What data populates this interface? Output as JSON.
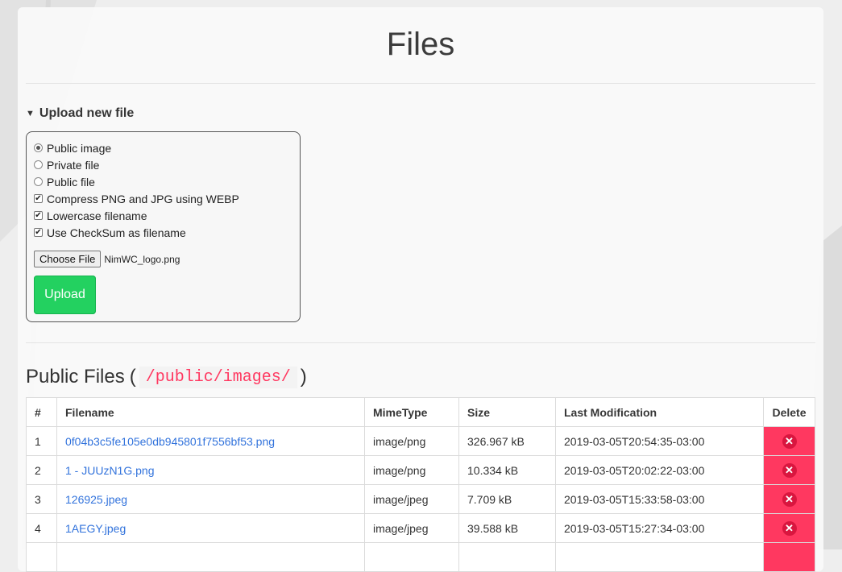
{
  "page": {
    "title": "Files"
  },
  "upload": {
    "summary": "Upload new file",
    "options": [
      {
        "type": "radio",
        "label": "Public image",
        "checked": true
      },
      {
        "type": "radio",
        "label": "Private file",
        "checked": false
      },
      {
        "type": "radio",
        "label": "Public file",
        "checked": false
      },
      {
        "type": "checkbox",
        "label": "Compress PNG and JPG using WEBP",
        "checked": true
      },
      {
        "type": "checkbox",
        "label": "Lowercase filename",
        "checked": true
      },
      {
        "type": "checkbox",
        "label": "Use CheckSum as filename",
        "checked": true
      }
    ],
    "choose_file_label": "Choose File",
    "chosen_file": "NimWC_logo.png",
    "upload_label": "Upload"
  },
  "public_files": {
    "title": "Public Files",
    "path": "/public/images/",
    "columns": [
      "#",
      "Filename",
      "MimeType",
      "Size",
      "Last Modification",
      "Delete"
    ],
    "rows": [
      {
        "num": "1",
        "filename": "0f04b3c5fe105e0db945801f7556bf53.png",
        "mime": "image/png",
        "size": "326.967 kB",
        "modified": "2019-03-05T20:54:35-03:00"
      },
      {
        "num": "2",
        "filename": "1 - JUUzN1G.png",
        "mime": "image/png",
        "size": "10.334 kB",
        "modified": "2019-03-05T20:02:22-03:00"
      },
      {
        "num": "3",
        "filename": "126925.jpeg",
        "mime": "image/jpeg",
        "size": "7.709 kB",
        "modified": "2019-03-05T15:33:58-03:00"
      },
      {
        "num": "4",
        "filename": "1AEGY.jpeg",
        "mime": "image/jpeg",
        "size": "39.588 kB",
        "modified": "2019-03-05T15:27:34-03:00"
      }
    ]
  },
  "colors": {
    "accent_green": "#23d160",
    "danger": "#ff3860",
    "link": "#3273dc"
  },
  "icons": {
    "delete": "delete-icon",
    "summary_marker": "triangle-down-icon"
  }
}
